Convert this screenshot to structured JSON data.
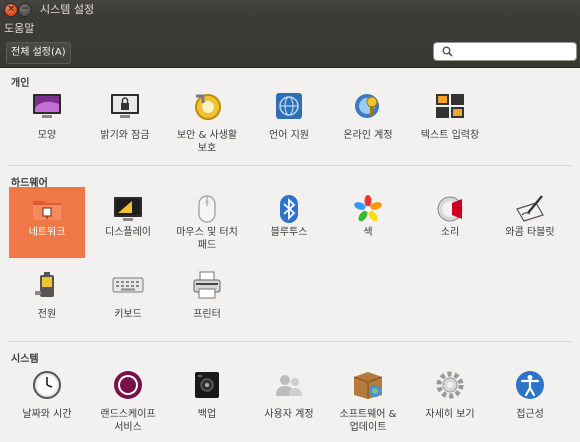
{
  "window": {
    "title": "시스템 설정",
    "close_glyph": "×",
    "min_glyph": "−"
  },
  "menubar": {
    "help": "도움말"
  },
  "toolbar": {
    "all_settings": "전체 설정(A)",
    "search_placeholder": ""
  },
  "sections": {
    "personal": {
      "title": "개인",
      "items": [
        {
          "label": "모양",
          "icon": "appearance-icon"
        },
        {
          "label": "밝기와 잠금",
          "icon": "brightness-lock-icon"
        },
        {
          "label": "보안 & 사생활",
          "label2": "보호",
          "icon": "security-privacy-icon"
        },
        {
          "label": "언어 지원",
          "icon": "language-support-icon"
        },
        {
          "label": "온라인 계정",
          "icon": "online-accounts-icon"
        },
        {
          "label": "텍스트 입력창",
          "icon": "text-entry-icon"
        }
      ]
    },
    "hardware": {
      "title": "하드웨어",
      "items": [
        {
          "label": "네트워크",
          "icon": "network-icon",
          "selected": true
        },
        {
          "label": "디스플레이",
          "icon": "displays-icon"
        },
        {
          "label": "마우스 및 터치",
          "label2": "패드",
          "icon": "mouse-touchpad-icon"
        },
        {
          "label": "블루투스",
          "icon": "bluetooth-icon"
        },
        {
          "label": "색",
          "icon": "color-icon"
        },
        {
          "label": "소리",
          "icon": "sound-icon"
        },
        {
          "label": "와콤 타블릿",
          "icon": "wacom-tablet-icon"
        },
        {
          "label": "전원",
          "icon": "power-icon"
        },
        {
          "label": "키보드",
          "icon": "keyboard-icon"
        },
        {
          "label": "프린터",
          "icon": "printers-icon"
        }
      ]
    },
    "system": {
      "title": "시스템",
      "items": [
        {
          "label": "날짜와 시간",
          "icon": "time-date-icon"
        },
        {
          "label": "랜드스케이프",
          "label2": "서비스",
          "icon": "landscape-service-icon"
        },
        {
          "label": "백업",
          "icon": "backups-icon"
        },
        {
          "label": "사용자 계정",
          "icon": "user-accounts-icon"
        },
        {
          "label": "소프트웨어 &",
          "label2": "업데이트",
          "icon": "software-updates-icon"
        },
        {
          "label": "자세히 보기",
          "icon": "details-icon"
        },
        {
          "label": "접근성",
          "icon": "universal-access-icon"
        }
      ]
    }
  },
  "colors": {
    "selection": "#f07746",
    "titlebar": "#3b3a36",
    "close": "#df4b16"
  }
}
